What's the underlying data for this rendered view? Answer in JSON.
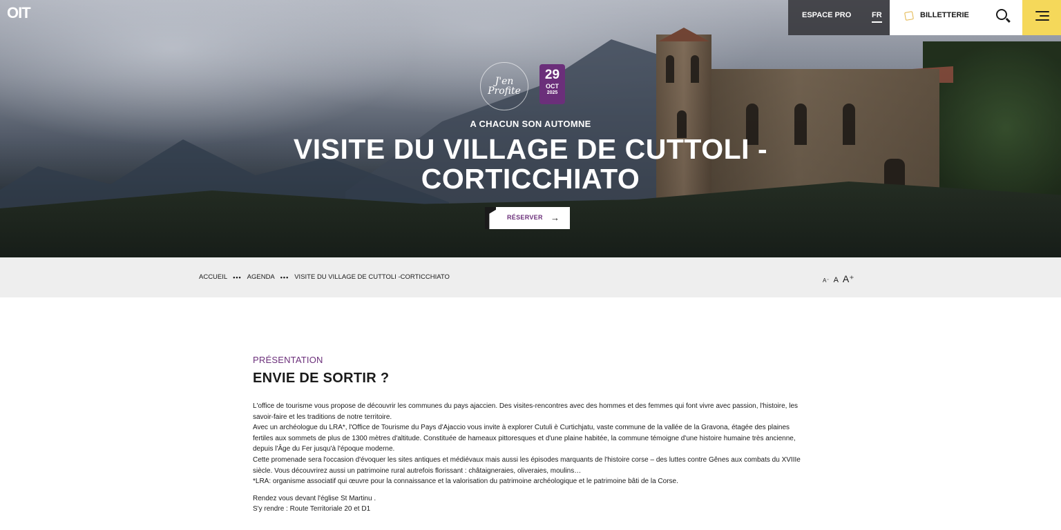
{
  "header": {
    "logo_text": "OIT",
    "espace_pro": "ESPACE PRO",
    "language": "FR",
    "billetterie": "BILLETTERIE"
  },
  "hero": {
    "badge_text": "J'en Profite",
    "date": {
      "day": "29",
      "month": "OCT",
      "year": "2025"
    },
    "kicker": "A CHACUN SON AUTOMNE",
    "title": "VISITE DU VILLAGE DE CUTTOLI - CORTICCHIATO",
    "reserve_label": "RÉSERVER",
    "reserve_arrow": "→"
  },
  "breadcrumb": {
    "items": [
      "ACCUEIL",
      "AGENDA",
      "VISITE DU VILLAGE DE CUTTOLI -CORTICCHIATO"
    ],
    "separator": "•••"
  },
  "font_size_controls": {
    "decrease": "A⁻",
    "normal": "A",
    "increase": "A⁺"
  },
  "presentation": {
    "kicker": "PRÉSENTATION",
    "title": "ENVIE DE SORTIR ?",
    "paragraphs": [
      "L'office de tourisme vous propose de découvrir les communes du pays ajaccien. Des visites-rencontres avec des hommes et des femmes qui font vivre avec passion, l'histoire, les savoir-faire et les traditions de notre territoire.",
      "Avec un archéologue du LRA*, l'Office de Tourisme du Pays d'Ajaccio vous invite à explorer Cutuli è Curtichjatu, vaste commune de la vallée de la Gravona, étagée des plaines fertiles aux sommets de plus de 1300 mètres d'altitude. Constituée de hameaux pittoresques et d'une plaine habitée, la commune témoigne d'une histoire humaine très ancienne, depuis l'Âge du Fer jusqu'à l'époque moderne.",
      "Cette promenade sera l'occasion d'évoquer les sites antiques et médiévaux mais aussi les épisodes marquants de l'histoire corse – des luttes contre Gênes aux combats du XVIIIe siècle. Vous découvrirez aussi un patrimoine rural autrefois florissant : châtaigneraies, oliveraies, moulins…",
      "*LRA: organisme associatif qui œuvre pour la connaissance et la valorisation du patrimoine archéologique et le patrimoine bâti de la Corse."
    ],
    "meeting": "Rendez vous devant l'église St Martinu .",
    "directions": "S'y rendre : Route Territoriale 20 et D1"
  },
  "colors": {
    "accent_purple": "#6b2f7a",
    "menu_yellow": "#f5d85a",
    "ticket_orange": "#e3b54a"
  }
}
